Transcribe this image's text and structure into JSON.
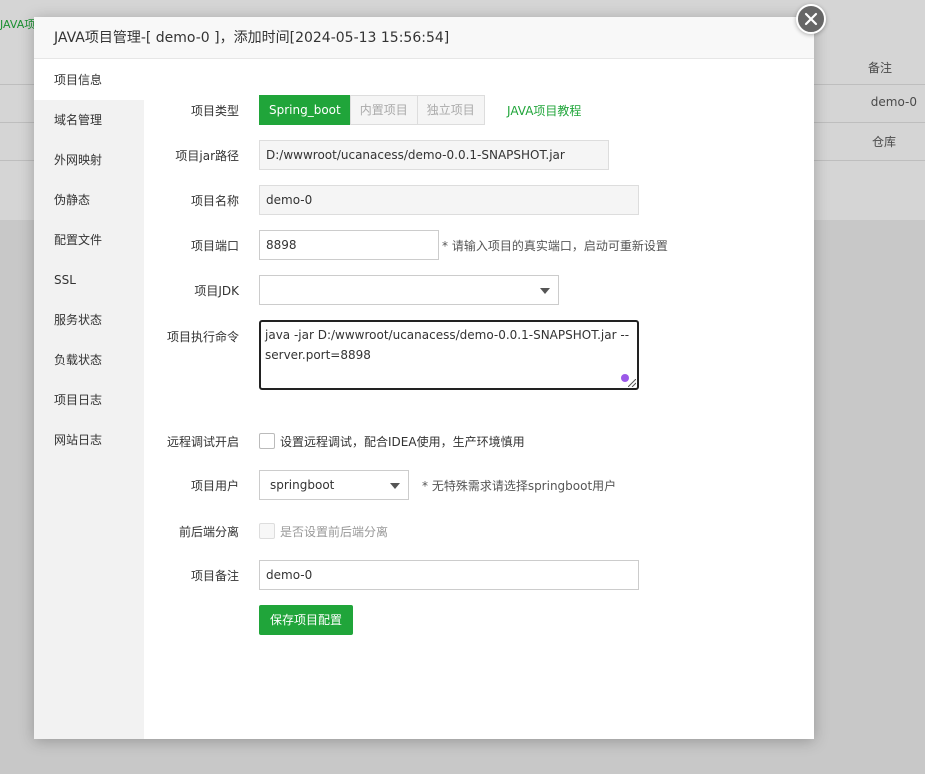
{
  "background": {
    "brand": "JAVA项",
    "col_header": "备注",
    "rows": [
      "demo-0",
      "仓库"
    ]
  },
  "dialog": {
    "title": "JAVA项目管理-[ demo-0 ]，添加时间[2024-05-13 15:56:54]",
    "close_icon": "close-icon"
  },
  "sidebar": {
    "items": [
      {
        "label": "项目信息"
      },
      {
        "label": "域名管理"
      },
      {
        "label": "外网映射"
      },
      {
        "label": "伪静态"
      },
      {
        "label": "配置文件"
      },
      {
        "label": "SSL"
      },
      {
        "label": "服务状态"
      },
      {
        "label": "负载状态"
      },
      {
        "label": "项目日志"
      },
      {
        "label": "网站日志"
      }
    ]
  },
  "form": {
    "type": {
      "label": "项目类型",
      "options": [
        "Spring_boot",
        "内置项目",
        "独立项目"
      ],
      "selected": "Spring_boot",
      "tutorial_link": "JAVA项目教程"
    },
    "jar_path": {
      "label": "项目jar路径",
      "value": "D:/wwwroot/ucanacess/demo-0.0.1-SNAPSHOT.jar"
    },
    "name": {
      "label": "项目名称",
      "value": "demo-0"
    },
    "port": {
      "label": "项目端口",
      "value": "8898",
      "hint": "* 请输入项目的真实端口，启动可重新设置"
    },
    "jdk": {
      "label": "项目JDK",
      "value": ""
    },
    "command": {
      "label": "项目执行命令",
      "value": "java -jar D:/wwwroot/ucanacess/demo-0.0.1-SNAPSHOT.jar --server.port=8898"
    },
    "remote_debug": {
      "label": "远程调试开启",
      "text": "设置远程调试，配合IDEA使用，生产环境慎用"
    },
    "user": {
      "label": "项目用户",
      "value": "springboot",
      "hint": "* 无特殊需求请选择springboot用户"
    },
    "separation": {
      "label": "前后端分离",
      "text": "是否设置前后端分离"
    },
    "remark": {
      "label": "项目备注",
      "value": "demo-0"
    },
    "save_label": "保存项目配置"
  },
  "colors": {
    "accent": "#20a53a"
  }
}
